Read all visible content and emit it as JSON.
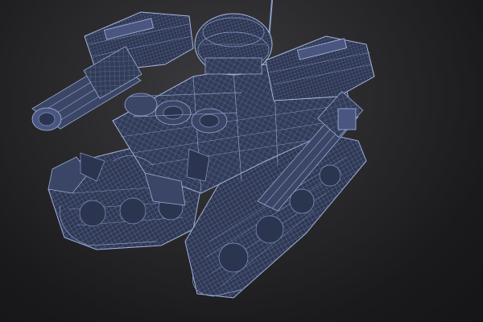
{
  "scene": {
    "subject": "tank-wireframe-model",
    "colors": {
      "background": "#1b1b1d",
      "wire": "#8a9cc8",
      "fill": "#3b4666"
    }
  }
}
